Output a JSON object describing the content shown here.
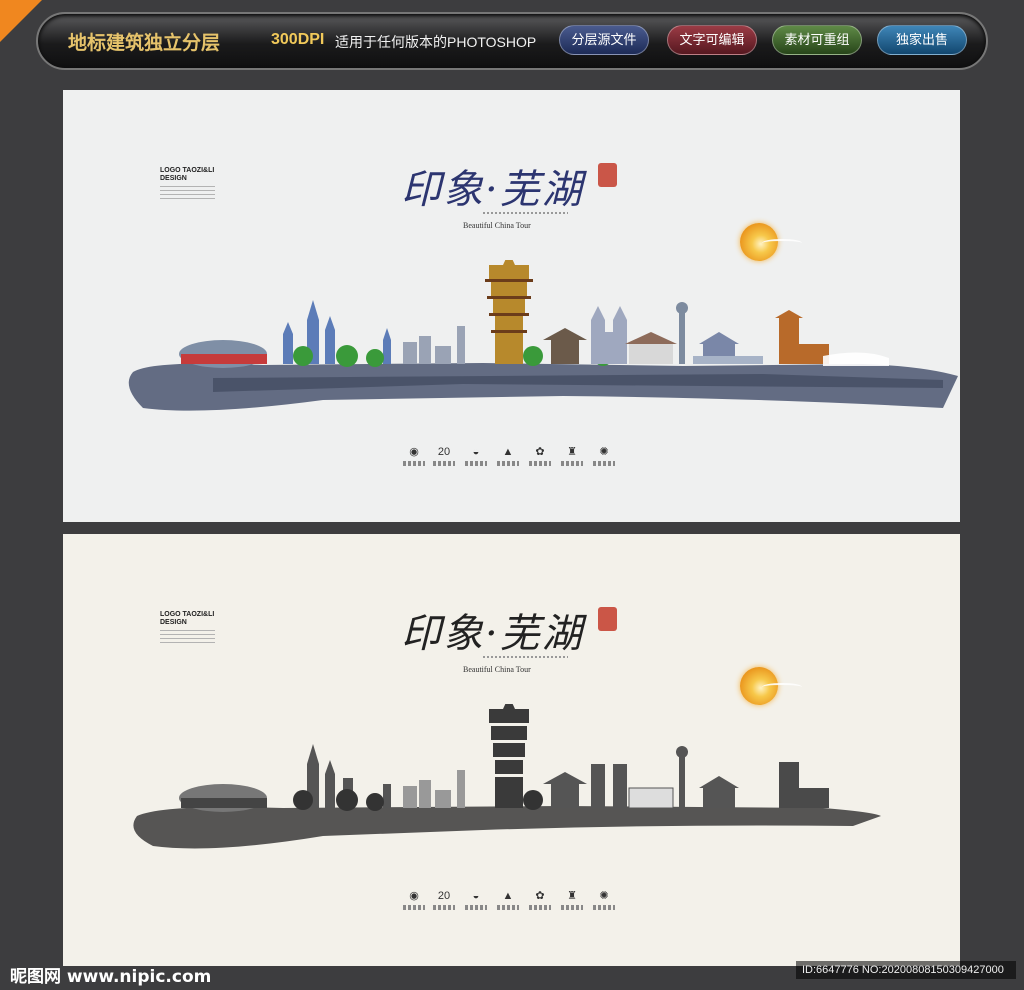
{
  "header": {
    "title": "地标建筑独立分层",
    "dpi": "300DPI",
    "description": "适用于任何版本的PHOTOSHOP",
    "buttons": [
      "分层源文件",
      "文字可编辑",
      "素材可重组",
      "独家出售"
    ]
  },
  "posters": [
    {
      "logo": "LOGO TAOZI&LI DESIGN",
      "calligraphy": "印象·芜湖",
      "tagline": "Beautiful China Tour",
      "icons_number": "20",
      "title_color": "#2c3570"
    },
    {
      "logo": "LOGO TAOZI&LI DESIGN",
      "calligraphy": "印象·芜湖",
      "tagline": "Beautiful China Tour",
      "icons_number": "20",
      "title_color": "#222222"
    }
  ],
  "footer": {
    "brand": "昵图网 www.nipic.com",
    "id": "ID:6647776 NO:20200808150309427000"
  },
  "colors": {
    "accent": "#f0871f",
    "sun": "#f3b54a"
  }
}
